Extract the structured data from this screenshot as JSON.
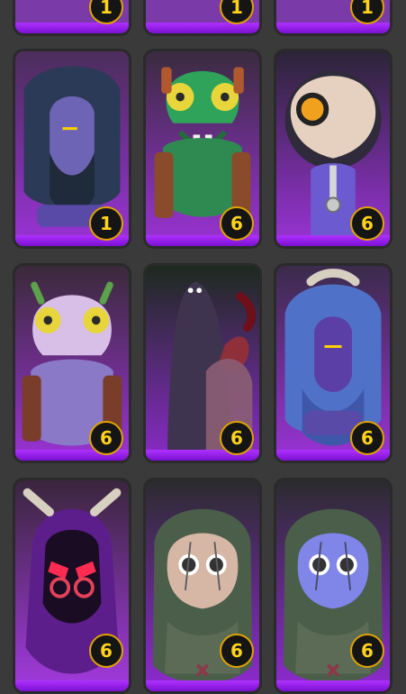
{
  "grid": {
    "cards": [
      {
        "id": "r0c0",
        "character": "partial-top-card",
        "cost": "1",
        "color": "#7a3aa8"
      },
      {
        "id": "r0c1",
        "character": "partial-top-card",
        "cost": "1",
        "color": "#7a3aa8"
      },
      {
        "id": "r0c2",
        "character": "partial-top-card",
        "cost": "1",
        "color": "#7a3aa8"
      },
      {
        "id": "r1c0",
        "character": "bearded-hooded-spirit",
        "cost": "1",
        "color": "#6b4fa0"
      },
      {
        "id": "r1c1",
        "character": "green-frog-creature",
        "cost": "6",
        "color": "#2f8a52"
      },
      {
        "id": "r1c2",
        "character": "mummy-cyclops",
        "cost": "6",
        "color": "#6b47a8"
      },
      {
        "id": "r2c0",
        "character": "pink-frog-creature",
        "cost": "6",
        "color": "#8e78c8"
      },
      {
        "id": "r2c1",
        "character": "tall-shadow-and-horned",
        "cost": "6",
        "color": "#4c3f7a"
      },
      {
        "id": "r2c2",
        "character": "blue-haired-bearded-spirit",
        "cost": "6",
        "color": "#5e66b6"
      },
      {
        "id": "r3c0",
        "character": "hooded-assassin",
        "cost": "6",
        "color": "#6f2aa0"
      },
      {
        "id": "r3c1",
        "character": "masked-leaf-creature-tan",
        "cost": "6",
        "color": "#6a7b60"
      },
      {
        "id": "r3c2",
        "character": "masked-leaf-creature-blue",
        "cost": "6",
        "color": "#5f6c8a"
      }
    ]
  }
}
